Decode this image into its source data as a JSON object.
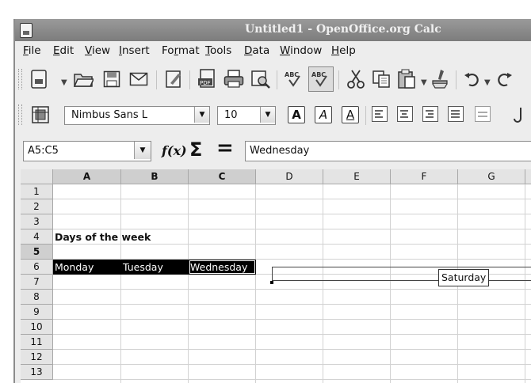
{
  "window": {
    "title": "Untitled1 - OpenOffice.org Calc"
  },
  "menu": {
    "items": [
      {
        "first": "F",
        "rest": "ile"
      },
      {
        "first": "E",
        "rest": "dit"
      },
      {
        "first": "V",
        "rest": "iew"
      },
      {
        "first": "I",
        "rest": "nsert"
      },
      {
        "first": "F",
        "rest": "o",
        "mid": "r",
        "end": "mat"
      },
      {
        "first": "T",
        "rest": "ools"
      },
      {
        "first": "D",
        "rest": "ata"
      },
      {
        "first": "W",
        "rest": "indow"
      },
      {
        "first": "H",
        "rest": "elp"
      }
    ],
    "labels": [
      "File",
      "Edit",
      "View",
      "Insert",
      "Format",
      "Tools",
      "Data",
      "Window",
      "Help"
    ]
  },
  "toolbar": {
    "icons": [
      "new-document-icon",
      "open-folder-icon",
      "save-icon",
      "email-icon",
      "edit-file-icon",
      "export-pdf-icon",
      "print-icon",
      "print-preview-icon",
      "spellcheck-icon",
      "autospellcheck-icon",
      "cut-icon",
      "copy-icon",
      "paste-icon",
      "format-paintbrush-icon",
      "undo-icon",
      "redo-icon"
    ],
    "spell_label": "ABC",
    "pdf_label": "PDF"
  },
  "format_toolbar": {
    "font_name": "Nimbus Sans L",
    "font_size": "10",
    "bold": "A",
    "italic": "A",
    "underline": "A"
  },
  "formula_bar": {
    "name_box": "A5:C5",
    "fx_label": "f(x)",
    "sum_symbol": "Σ",
    "equals_symbol": "=",
    "content": "Wednesday"
  },
  "sheet": {
    "columns": [
      "A",
      "B",
      "C",
      "D",
      "E",
      "F",
      "G"
    ],
    "selected_columns": [
      "A",
      "B",
      "C"
    ],
    "rows": [
      "1",
      "2",
      "3",
      "4",
      "5",
      "6",
      "7",
      "8",
      "9",
      "10",
      "11",
      "12",
      "13"
    ],
    "selected_row": "5",
    "cells": {
      "A3": "Days of the week",
      "A5": "Monday",
      "B5": "Tuesday",
      "C5": "Wednesday"
    },
    "autofill_tooltip": "Saturday"
  }
}
